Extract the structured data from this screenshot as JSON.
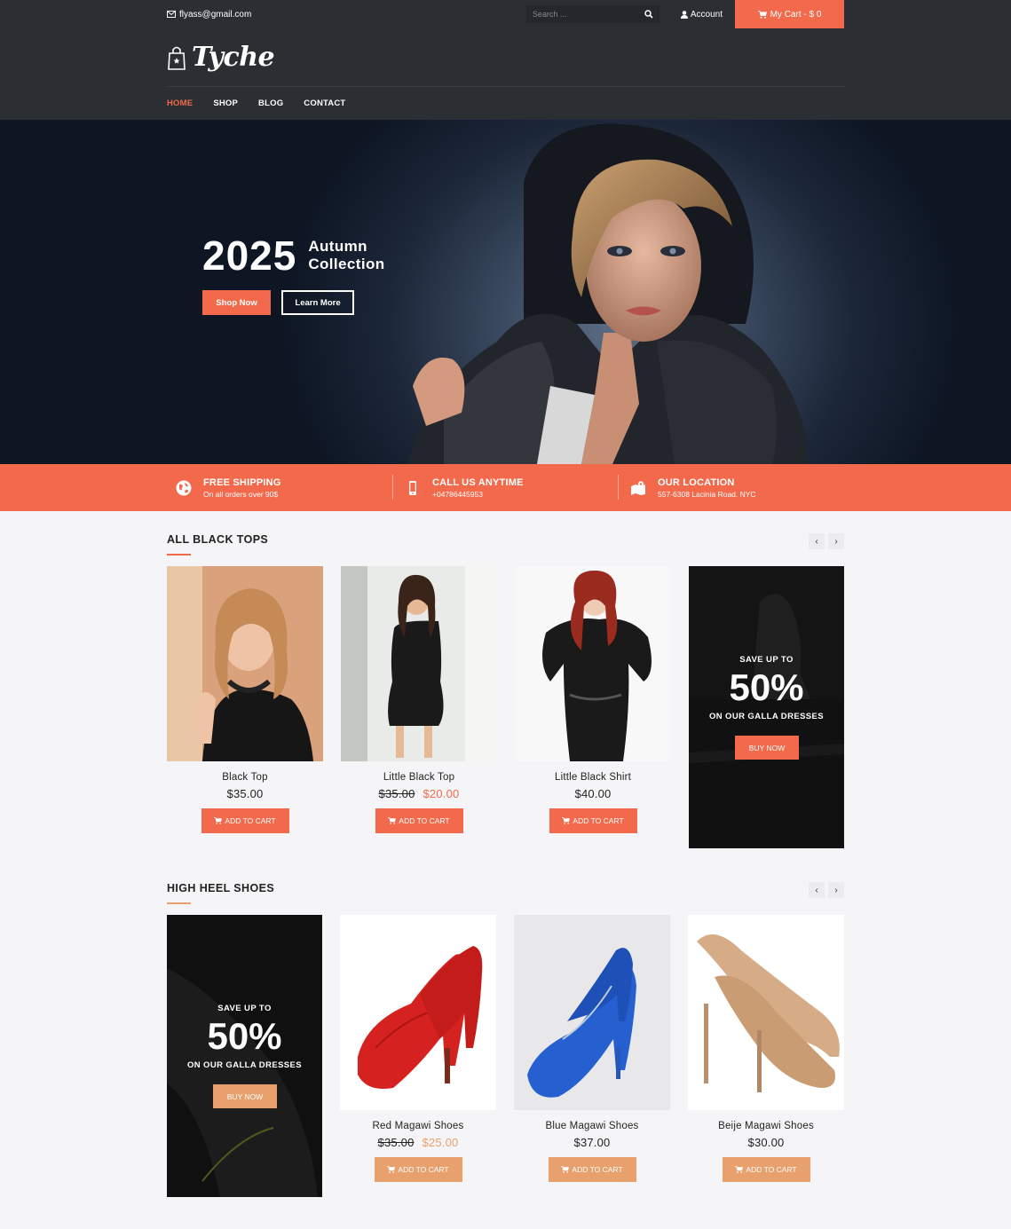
{
  "topbar": {
    "email": "flyass@gmail.com",
    "search_placeholder": "Search ...",
    "account_label": "Account",
    "cart_label": "My Cart - $ 0"
  },
  "header": {
    "logo_text": "Tyche",
    "nav": [
      "HOME",
      "SHOP",
      "BLOG",
      "CONTACT"
    ]
  },
  "hero": {
    "year": "2025",
    "subtitle_line1": "Autumn",
    "subtitle_line2": "Collection",
    "shop_now": "Shop Now",
    "learn_more": "Learn More"
  },
  "features": [
    {
      "title": "FREE SHIPPING",
      "sub": "On all orders over 90$",
      "icon": "globe-icon"
    },
    {
      "title": "CALL US ANYTIME",
      "sub": "+04786445953",
      "icon": "phone-icon"
    },
    {
      "title": "OUR LOCATION",
      "sub": "557-6308 Lacinia Road. NYC",
      "icon": "map-icon"
    }
  ],
  "section1": {
    "title": "ALL BLACK TOPS",
    "products": [
      {
        "name": "Black Top",
        "price": "$35.00"
      },
      {
        "name": "Little Black Top",
        "old_price": "$35.00",
        "sale_price": "$20.00"
      },
      {
        "name": "Little Black Shirt",
        "price": "$40.00"
      }
    ],
    "promo": {
      "top": "SAVE UP TO",
      "big": "50%",
      "bottom": "ON OUR GALLA DRESSES",
      "button": "BUY NOW"
    }
  },
  "section2": {
    "title": "HIGH HEEL SHOES",
    "promo": {
      "top": "SAVE UP TO",
      "big": "50%",
      "bottom": "ON OUR GALLA DRESSES",
      "button": "BUY NOW"
    },
    "products": [
      {
        "name": "Red Magawi Shoes",
        "old_price": "$35.00",
        "sale_price": "$25.00"
      },
      {
        "name": "Blue Magawi Shoes",
        "price": "$37.00"
      },
      {
        "name": "Beije Magawi Shoes",
        "price": "$30.00"
      }
    ]
  },
  "add_to_cart": "ADD TO CART",
  "colors": {
    "accent": "#f26a4b",
    "accent_tan": "#e8a06c",
    "dark": "#2b2e33"
  }
}
